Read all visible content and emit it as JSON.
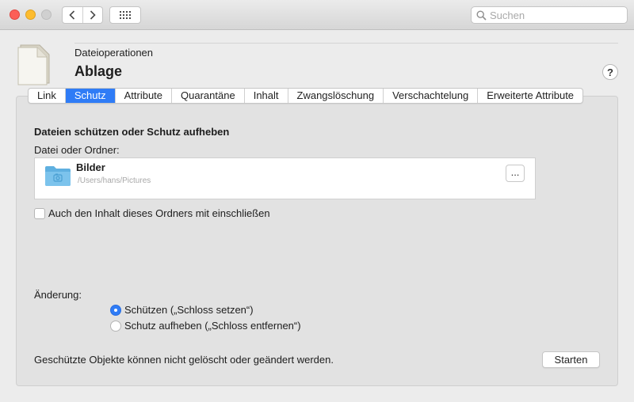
{
  "titlebar": {
    "search_placeholder": "Suchen",
    "icons": [
      "back-chevron",
      "forward-chevron",
      "grid-icon",
      "magnifier-icon"
    ]
  },
  "header": {
    "subtitle": "Dateioperationen",
    "title": "Ablage",
    "help_label": "?"
  },
  "tabs": [
    {
      "label": "Link",
      "active": false
    },
    {
      "label": "Schutz",
      "active": true
    },
    {
      "label": "Attribute",
      "active": false
    },
    {
      "label": "Quarantäne",
      "active": false
    },
    {
      "label": "Inhalt",
      "active": false
    },
    {
      "label": "Zwangslöschung",
      "active": false
    },
    {
      "label": "Verschachtelung",
      "active": false
    },
    {
      "label": "Erweiterte Attribute",
      "active": false
    }
  ],
  "main": {
    "section_title": "Dateien schützen oder Schutz aufheben",
    "file_label": "Datei oder Ordner:",
    "file": {
      "name": "Bilder",
      "path": "/Users/hans/Pictures",
      "browse_label": "..."
    },
    "include_contents_label": "Auch den Inhalt dieses Ordners mit einschließen",
    "include_contents_checked": false,
    "change_label": "Änderung:",
    "options": [
      {
        "label": "Schützen („Schloss setzen“)",
        "checked": true
      },
      {
        "label": "Schutz aufheben („Schloss entfernen“)",
        "checked": false
      }
    ],
    "footer_note": "Geschützte Objekte können nicht gelöscht oder geändert werden.",
    "start_label": "Starten"
  },
  "colors": {
    "accent": "#2f7cf6",
    "close": "#fc5f57",
    "minimize": "#fdbc2e",
    "folder": "#7cc3ec"
  }
}
